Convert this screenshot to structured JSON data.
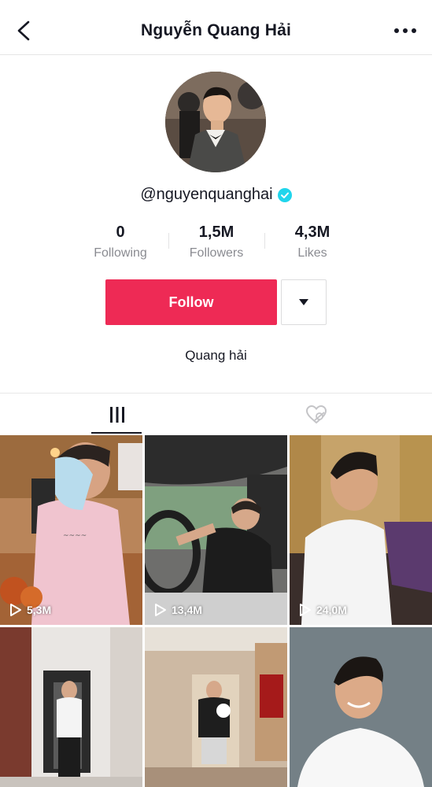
{
  "header": {
    "title": "Nguyễn Quang Hải",
    "back_icon": "chevron-left-icon",
    "more_icon": "more-horizontal-icon"
  },
  "profile": {
    "handle": "@nguyenquanghai",
    "verified": true,
    "bio": "Quang hải"
  },
  "stats": [
    {
      "value": "0",
      "label": "Following"
    },
    {
      "value": "1,5M",
      "label": "Followers"
    },
    {
      "value": "4,3M",
      "label": "Likes"
    }
  ],
  "actions": {
    "follow_label": "Follow",
    "dropdown_icon": "caret-down-icon"
  },
  "tabs": [
    {
      "icon": "videos-grid-icon",
      "active": true
    },
    {
      "icon": "liked-hidden-icon",
      "active": false
    }
  ],
  "videos": [
    {
      "views": "5,3M"
    },
    {
      "views": "13,4M"
    },
    {
      "views": "24,0M"
    },
    {
      "views": ""
    },
    {
      "views": ""
    },
    {
      "views": ""
    }
  ],
  "colors": {
    "accent": "#ee2a55",
    "verified": "#20d5ec",
    "muted": "#8a8b91"
  }
}
